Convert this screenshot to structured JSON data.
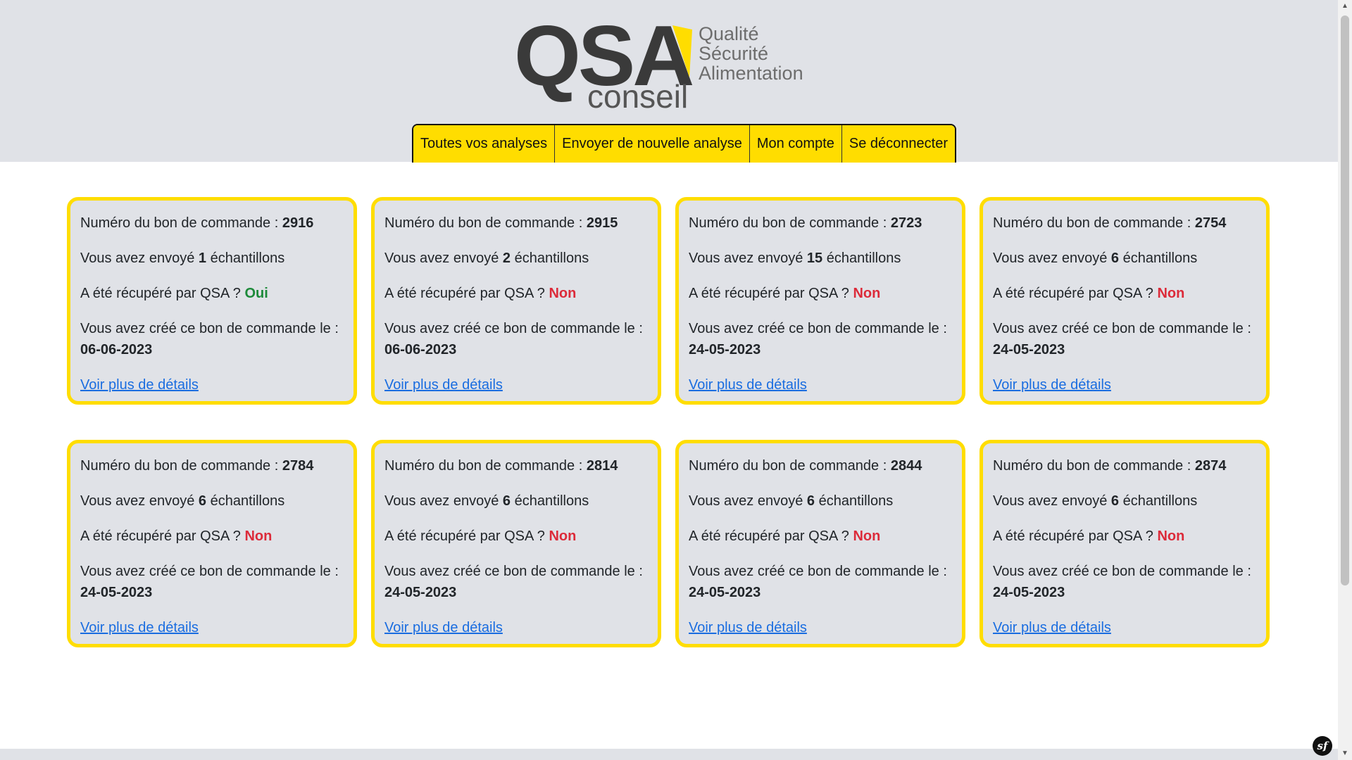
{
  "logo": {
    "brand": "QSA",
    "sub": "conseil",
    "tagline": [
      "Qualité",
      "Sécurité",
      "Alimentation"
    ],
    "accent_color": "#ffdd00"
  },
  "nav": {
    "items": [
      "Toutes vos analyses",
      "Envoyer de nouvelle analyse",
      "Mon compte",
      "Se déconnecter"
    ]
  },
  "labels": {
    "order_number": "Numéro du bon de commande : ",
    "sent_prefix": "Vous avez envoyé ",
    "sent_suffix": " échantillons",
    "picked_up": "A été récupéré par QSA ? ",
    "created": "Vous avez créé ce bon de commande le :",
    "details_link": "Voir plus de détails"
  },
  "orders": [
    {
      "number": "2916",
      "samples": "1",
      "picked_up": "Oui",
      "date": "06-06-2023"
    },
    {
      "number": "2915",
      "samples": "2",
      "picked_up": "Non",
      "date": "06-06-2023"
    },
    {
      "number": "2723",
      "samples": "15",
      "picked_up": "Non",
      "date": "24-05-2023"
    },
    {
      "number": "2754",
      "samples": "6",
      "picked_up": "Non",
      "date": "24-05-2023"
    },
    {
      "number": "2784",
      "samples": "6",
      "picked_up": "Non",
      "date": "24-05-2023"
    },
    {
      "number": "2814",
      "samples": "6",
      "picked_up": "Non",
      "date": "24-05-2023"
    },
    {
      "number": "2844",
      "samples": "6",
      "picked_up": "Non",
      "date": "24-05-2023"
    },
    {
      "number": "2874",
      "samples": "6",
      "picked_up": "Non",
      "date": "24-05-2023"
    }
  ],
  "colors": {
    "yes": "#1d8a3a",
    "no": "#dc2b3a",
    "link": "#1a6de0",
    "card_border": "#ffdd00",
    "card_bg": "#e0e2e7"
  },
  "debug_badge": "sf"
}
